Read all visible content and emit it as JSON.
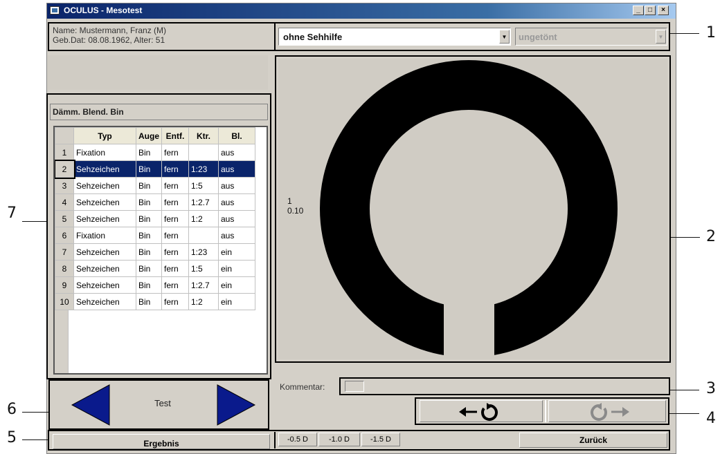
{
  "window": {
    "title": "OCULUS - Mesotest",
    "controls": [
      "_",
      "□",
      "×"
    ]
  },
  "patient": {
    "name_line": "Name: Mustermann, Franz (M)",
    "dob_line": "Geb.Dat: 08.08.1962, Alter: 51"
  },
  "selects": {
    "correction": "ohne Sehhilfe",
    "tint": "ungetönt"
  },
  "table": {
    "title": "Dämm. Blend. Bin",
    "columns": [
      "Typ",
      "Auge",
      "Entf.",
      "Ktr.",
      "Bl."
    ],
    "rows": [
      [
        "1",
        "Fixation",
        "Bin",
        "fern",
        "",
        "aus"
      ],
      [
        "2",
        "Sehzeichen",
        "Bin",
        "fern",
        "1:23",
        "aus"
      ],
      [
        "3",
        "Sehzeichen",
        "Bin",
        "fern",
        "1:5",
        "aus"
      ],
      [
        "4",
        "Sehzeichen",
        "Bin",
        "fern",
        "1:2.7",
        "aus"
      ],
      [
        "5",
        "Sehzeichen",
        "Bin",
        "fern",
        "1:2",
        "aus"
      ],
      [
        "6",
        "Fixation",
        "Bin",
        "fern",
        "",
        "aus"
      ],
      [
        "7",
        "Sehzeichen",
        "Bin",
        "fern",
        "1:23",
        "ein"
      ],
      [
        "8",
        "Sehzeichen",
        "Bin",
        "fern",
        "1:5",
        "ein"
      ],
      [
        "9",
        "Sehzeichen",
        "Bin",
        "fern",
        "1:2.7",
        "ein"
      ],
      [
        "10",
        "Sehzeichen",
        "Bin",
        "fern",
        "1:2",
        "ein"
      ]
    ],
    "selected_row": 2
  },
  "display": {
    "line1": "1",
    "line2": "0.10"
  },
  "comment": {
    "label": "Kommentar:"
  },
  "nav": {
    "test_label": "Test"
  },
  "bottom": {
    "ergebnis": "Ergebnis",
    "diopters": [
      "-0.5 D",
      "-1.0 D",
      "-1.5 D"
    ],
    "zuruck": "Zurück"
  },
  "callouts": [
    "1",
    "2",
    "3",
    "4",
    "5",
    "6",
    "7"
  ],
  "colors": {
    "title_bar": "#0a246a",
    "selection": "#0a246a",
    "nav_arrow": "#0a1a8c",
    "window_bg": "#d4d0c8"
  }
}
